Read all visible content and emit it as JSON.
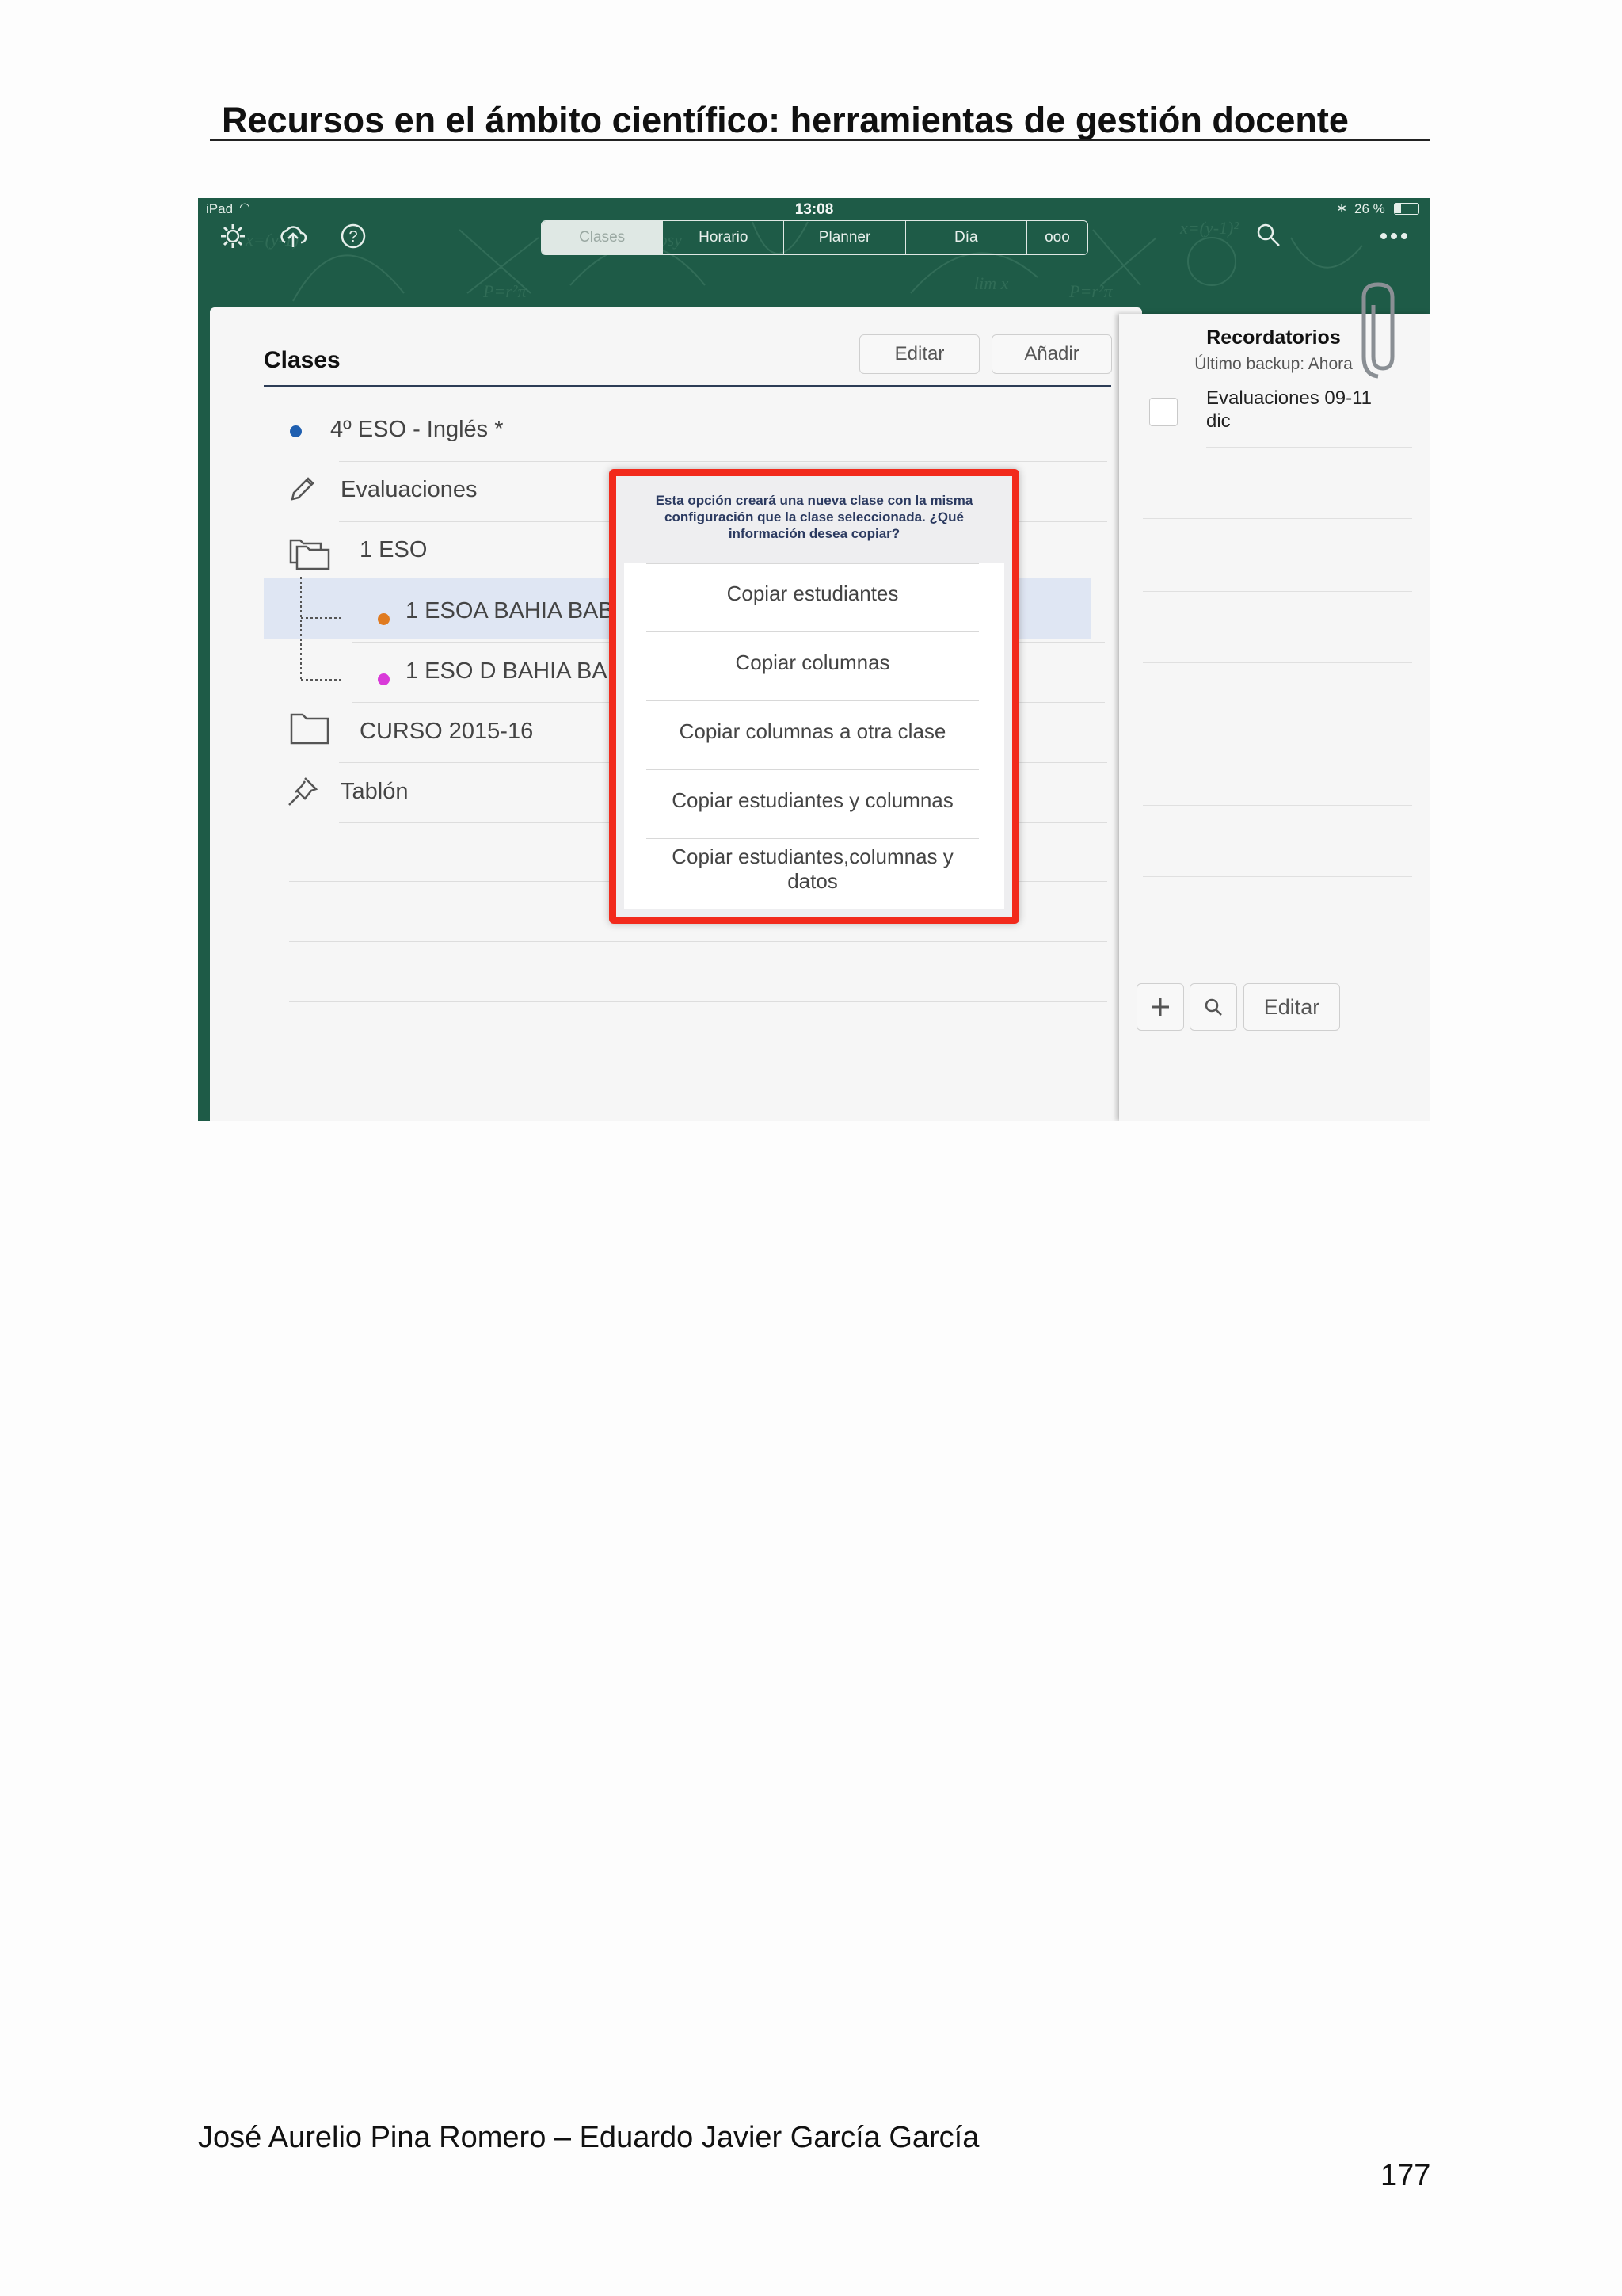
{
  "document": {
    "title": "Recursos en el ámbito científico: herramientas de gestión docente",
    "footer_authors": "José Aurelio Pina Romero – Eduardo Javier García García",
    "page_number": "177"
  },
  "screenshot": {
    "status": {
      "device": "iPad",
      "time": "13:08",
      "battery": "26 %"
    },
    "toolbar": {
      "left_icons": [
        "gear-icon",
        "cloud-upload-icon",
        "help-icon"
      ],
      "tabs": [
        {
          "label": "Clases",
          "active": true
        },
        {
          "label": "Horario",
          "active": false
        },
        {
          "label": "Planner",
          "active": false
        },
        {
          "label": "Día",
          "active": false
        },
        {
          "label": "ooo",
          "active": false
        }
      ],
      "right_icons": [
        "search-icon",
        "more-icon"
      ]
    },
    "classes_panel": {
      "title": "Clases",
      "edit_label": "Editar",
      "add_label": "Añadir",
      "items": [
        {
          "label": "4º ESO - Inglés *",
          "icon": "dot-icon",
          "color": "#1f5fb0"
        },
        {
          "label": "Evaluaciones",
          "icon": "pencil-icon"
        },
        {
          "label": "1 ESO",
          "icon": "folders-icon"
        },
        {
          "label": "1 ESOA  BAHIA BABEL",
          "icon": "dot-icon",
          "color": "#e07b20",
          "selected": true
        },
        {
          "label": "1 ESO D BAHIA BABEL",
          "icon": "dot-icon",
          "color": "#d93ad9"
        },
        {
          "label": "CURSO 2015-16",
          "icon": "folder-icon"
        },
        {
          "label": "Tablón",
          "icon": "pin-icon"
        }
      ]
    },
    "reminders": {
      "title": "Recordatorios",
      "subtitle": "Último backup: Ahora",
      "items": [
        {
          "label": "Evaluaciones 09-11 dic",
          "checked": false
        }
      ],
      "edit_label": "Editar"
    },
    "dialog": {
      "message": "Esta opción creará una nueva clase con la misma configuración que la clase seleccionada. ¿Qué información desea copiar?",
      "options": [
        "Copiar estudiantes",
        "Copiar columnas",
        "Copiar columnas a otra clase",
        "Copiar estudiantes y columnas",
        "Copiar estudiantes,columnas y datos"
      ],
      "highlight_color": "#f22a1c"
    }
  }
}
